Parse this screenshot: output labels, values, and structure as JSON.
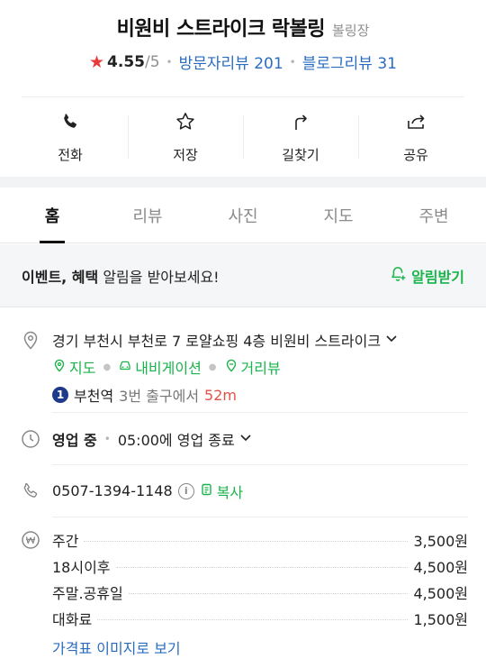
{
  "place": {
    "name": "비원비 스트라이크 락볼링",
    "category": "볼링장",
    "rating": "4.55",
    "rating_max": "/5",
    "visitor_reviews": "방문자리뷰 201",
    "blog_reviews": "블로그리뷰 31"
  },
  "actions": [
    {
      "label": "전화",
      "icon": "phone-icon"
    },
    {
      "label": "저장",
      "icon": "star-outline-icon"
    },
    {
      "label": "길찾기",
      "icon": "directions-icon"
    },
    {
      "label": "공유",
      "icon": "share-icon"
    }
  ],
  "tabs": [
    {
      "label": "홈",
      "active": true
    },
    {
      "label": "리뷰",
      "active": false
    },
    {
      "label": "사진",
      "active": false
    },
    {
      "label": "지도",
      "active": false
    },
    {
      "label": "주변",
      "active": false
    }
  ],
  "event": {
    "bold": "이벤트, 혜택",
    "text": " 알림을 받아보세요!",
    "button": "알림받기"
  },
  "address": {
    "text": "경기 부천시 부천로 7 로얄쇼핑 4층 비원비 스트라이크",
    "links": [
      "지도",
      "내비게이션",
      "거리뷰"
    ],
    "subway_line": "1",
    "subway_station": "부천역",
    "subway_exit": "3번 출구에서",
    "subway_distance": "52m"
  },
  "hours": {
    "status": "영업 중",
    "detail": "05:00에 영업 종료"
  },
  "phone": {
    "number": "0507-1394-1148",
    "info_symbol": "i",
    "copy_label": "복사"
  },
  "prices": {
    "items": [
      {
        "name": "주간",
        "value": "3,500원"
      },
      {
        "name": "18시이후",
        "value": "4,500원"
      },
      {
        "name": "주말.공휴일",
        "value": "4,500원"
      },
      {
        "name": "대화료",
        "value": "1,500원"
      }
    ],
    "more_label": "가격표 이미지로 보기"
  },
  "colors": {
    "accent_green": "#19b44a",
    "link_blue": "#2a6dc0",
    "star_red": "#e83a3a",
    "distance_red": "#e35247",
    "subway_line1": "#1e3a8a"
  }
}
